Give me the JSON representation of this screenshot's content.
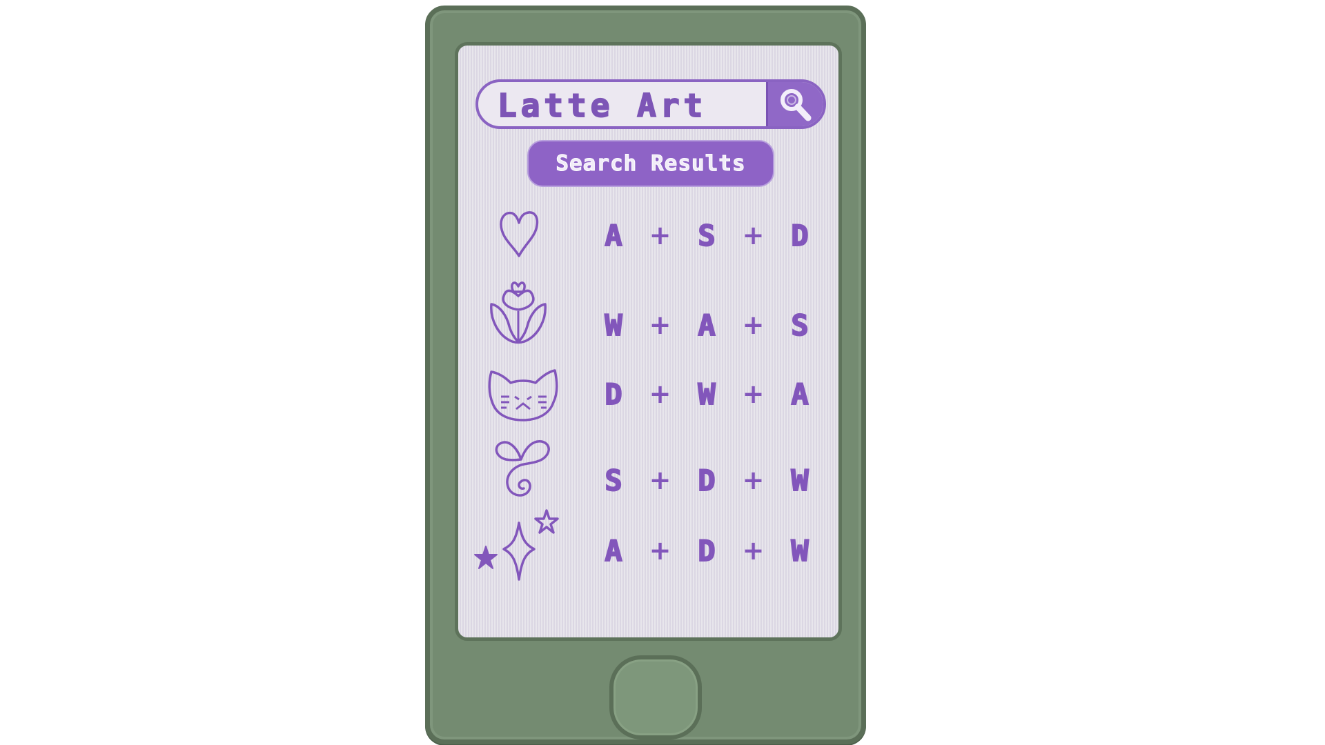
{
  "search": {
    "query": "Latte Art",
    "button_icon": "magnifier-icon"
  },
  "results_label": "Search Results",
  "colors": {
    "accent": "#8e63c6",
    "phone_body": "#748b71",
    "screen": "#e0dde6"
  },
  "results": [
    {
      "icon": "heart-icon",
      "keys": [
        "A",
        "S",
        "D"
      ]
    },
    {
      "icon": "rose-icon",
      "keys": [
        "W",
        "A",
        "S"
      ]
    },
    {
      "icon": "cat-face-icon",
      "keys": [
        "D",
        "W",
        "A"
      ]
    },
    {
      "icon": "swirl-heart-icon",
      "keys": [
        "S",
        "D",
        "W"
      ]
    },
    {
      "icon": "sparkle-stars-icon",
      "keys": [
        "A",
        "D",
        "W"
      ]
    }
  ],
  "separator": "+"
}
